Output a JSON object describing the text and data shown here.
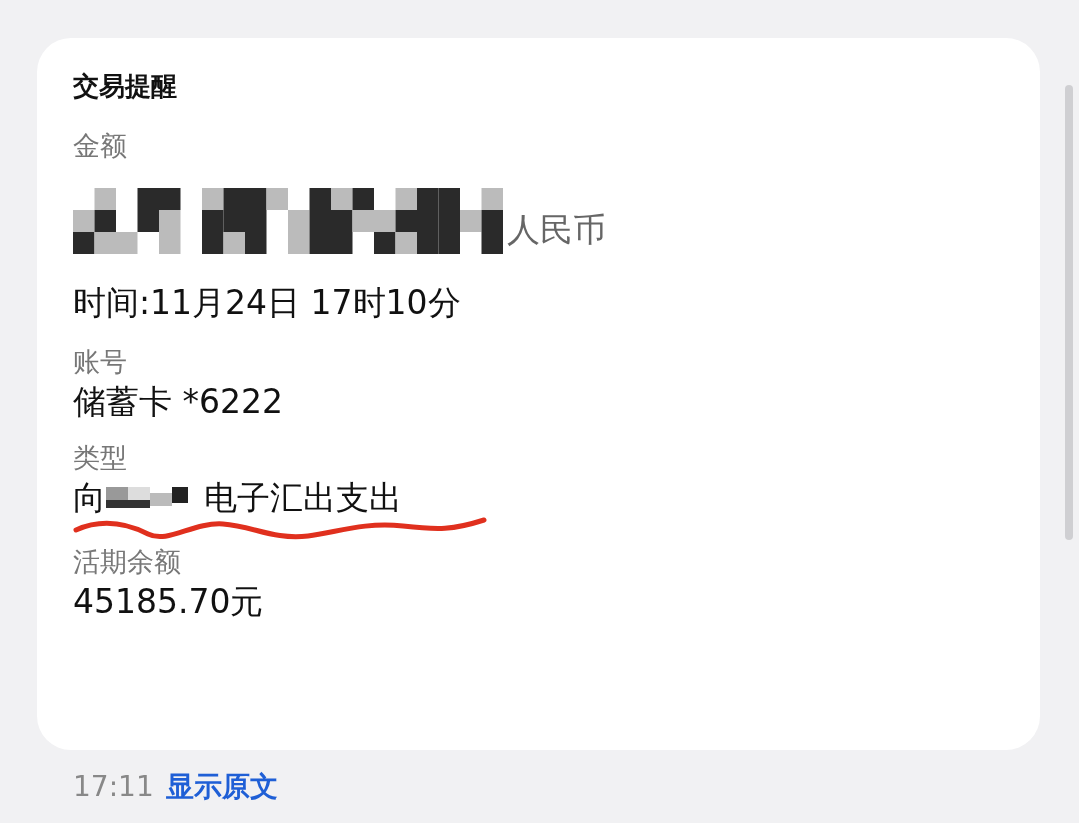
{
  "card": {
    "title": "交易提醒",
    "amount_label": "金额",
    "amount_currency": "人民币",
    "time": "时间:11月24日 17时10分",
    "account_label": "账号",
    "account": "储蓄卡 *6222",
    "type_label": "类型",
    "type_prefix": "向",
    "type_suffix": "电子汇出支出",
    "balance_label": "活期余额",
    "balance": "45185.70元"
  },
  "footer": {
    "time": "17:11",
    "link": "显示原文"
  }
}
